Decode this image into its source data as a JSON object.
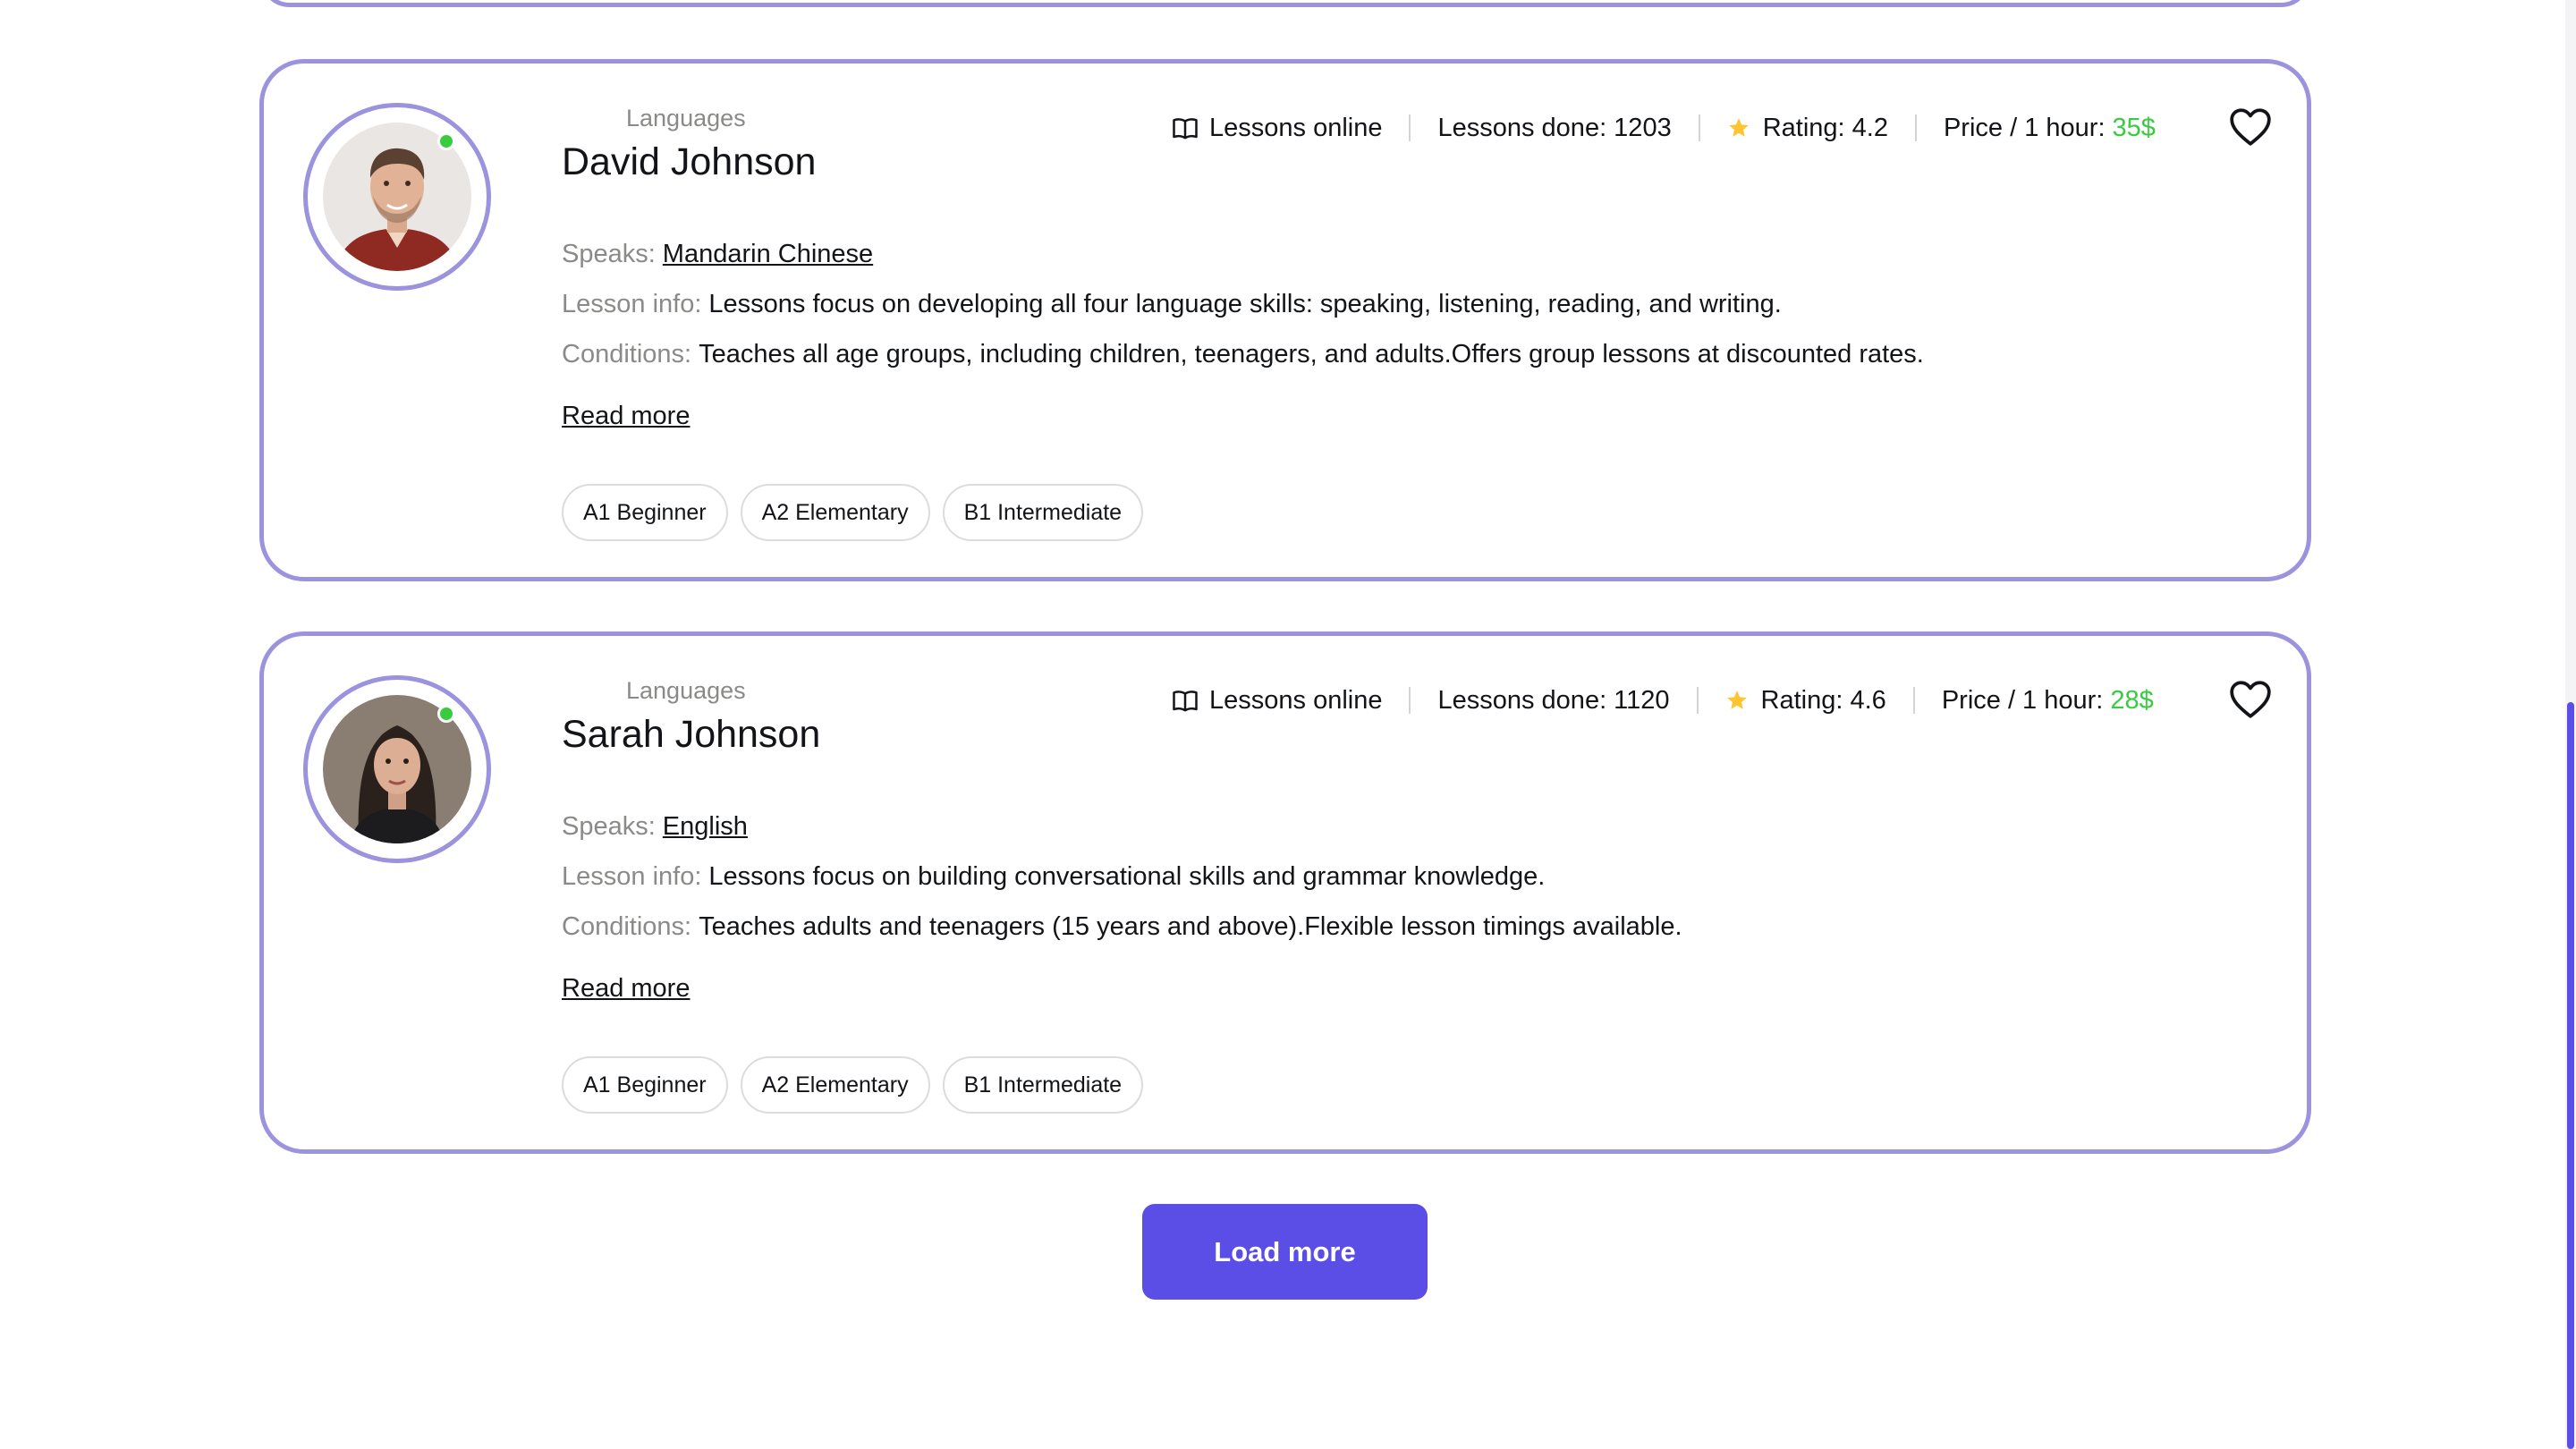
{
  "teachers": [
    {
      "category": "Languages",
      "name": "David Johnson",
      "lessons_online": "Lessons online",
      "lessons_done": "Lessons done: 1203",
      "rating": "Rating: 4.2",
      "price_label": "Price / 1 hour:",
      "price_value": "35$",
      "speaks_label": "Speaks:",
      "speaks_value": "Mandarin Chinese",
      "lesson_info_label": "Lesson info:",
      "lesson_info_value": "Lessons focus on developing all four language skills: speaking, listening, reading, and writing.",
      "conditions_label": "Conditions:",
      "conditions_value": "Teaches all age groups, including children, teenagers, and adults.Offers group lessons at discounted rates.",
      "read_more": "Read more",
      "levels": [
        "A1 Beginner",
        "A2 Elementary",
        "B1 Intermediate"
      ],
      "online": true
    },
    {
      "category": "Languages",
      "name": "Sarah Johnson",
      "lessons_online": "Lessons online",
      "lessons_done": "Lessons done: 1120",
      "rating": "Rating: 4.6",
      "price_label": "Price / 1 hour:",
      "price_value": "28$",
      "speaks_label": "Speaks:",
      "speaks_value": "English",
      "lesson_info_label": "Lesson info:",
      "lesson_info_value": "Lessons focus on building conversational skills and grammar knowledge.",
      "conditions_label": "Conditions:",
      "conditions_value": "Teaches adults and teenagers (15 years and above).Flexible lesson timings available.",
      "read_more": "Read more",
      "levels": [
        "A1 Beginner",
        "A2 Elementary",
        "B1 Intermediate"
      ],
      "online": true
    }
  ],
  "load_more_label": "Load more",
  "colors": {
    "accent": "#5b4ee7",
    "card_border": "#9b93de",
    "price": "#38cd3e",
    "star": "#ffc531",
    "muted_label": "#8a8a89"
  },
  "icons": {
    "lessons_online": "book-icon",
    "rating": "star-icon",
    "favorite": "heart-icon",
    "online_status": "online-dot"
  }
}
